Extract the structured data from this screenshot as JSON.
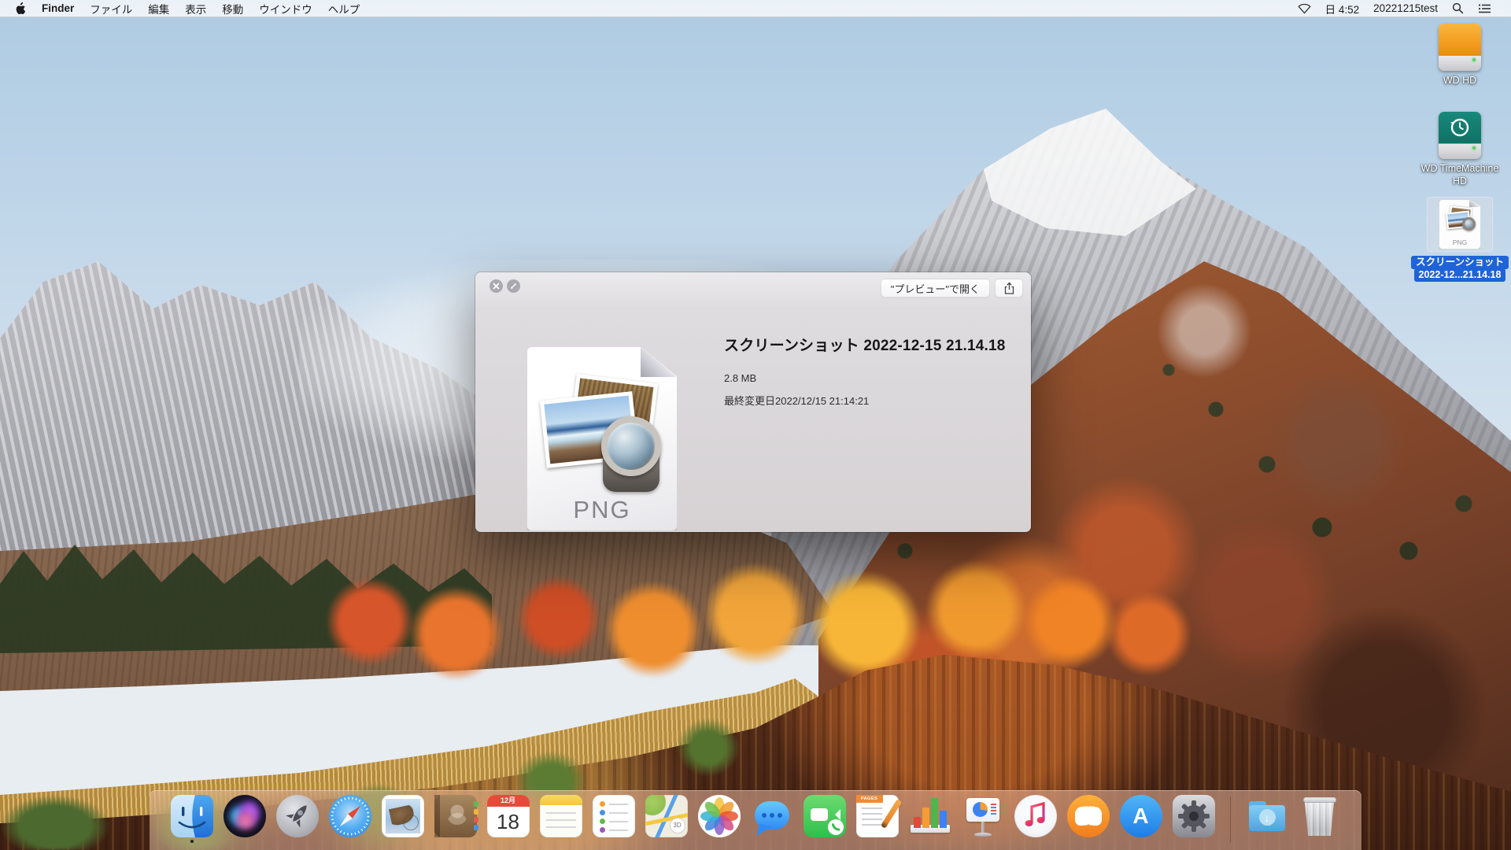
{
  "menu_bar": {
    "apple_icon": "apple-logo",
    "items": [
      "Finder",
      "ファイル",
      "編集",
      "表示",
      "移動",
      "ウインドウ",
      "ヘルプ"
    ],
    "status": {
      "wifi_icon": "wifi-no-signal",
      "clock": "日 4:52",
      "username": "20221215test",
      "search_icon": "magnifier",
      "notification_icon": "notification-list"
    }
  },
  "desktop": {
    "icons": [
      {
        "type": "external-drive-orange",
        "label": "WD HD"
      },
      {
        "type": "external-drive-timemachine",
        "label_line1": "WD TimeMachine",
        "label_line2": "HD"
      },
      {
        "type": "png-image-file",
        "selected": true,
        "badge": "PNG",
        "label_line1": "スクリーンショット",
        "label_line2": "2022-12...21.14.18"
      }
    ]
  },
  "quick_look": {
    "close_icon": "close",
    "fullscreen_icon": "fullscreen-diagonal-arrows",
    "open_button": "\"プレビュー\"で開く",
    "share_icon": "share",
    "file_badge": "PNG",
    "file_title": "スクリーンショット 2022-12-15 21.14.18",
    "file_size": "2.8 MB",
    "modified": "最終変更日2022/12/15 21:14:21"
  },
  "dock": {
    "apps": [
      "Finder",
      "Siri",
      "Launchpad",
      "Safari",
      "Mail",
      "Contacts",
      "Calendar",
      "Notes",
      "Reminders",
      "Maps",
      "Photos",
      "Messages",
      "FaceTime",
      "Pages",
      "Numbers",
      "Keynote",
      "iTunes",
      "iBooks",
      "App Store",
      "System Preferences",
      "Downloads",
      "Trash"
    ],
    "calendar": {
      "month": "12月",
      "day": "18"
    },
    "maps_badge": "3D",
    "pages_banner": "PAGES",
    "appstore_letter": "A",
    "running": [
      "Finder"
    ]
  },
  "colors": {
    "selection_blue": "#1f63d9",
    "menu_bar_bg": "#f9fafb",
    "window_bg": "#dad7da",
    "drive_orange": "#f19a1c",
    "drive_teal": "#0e7265",
    "dock_tint": "#eec5b4"
  }
}
